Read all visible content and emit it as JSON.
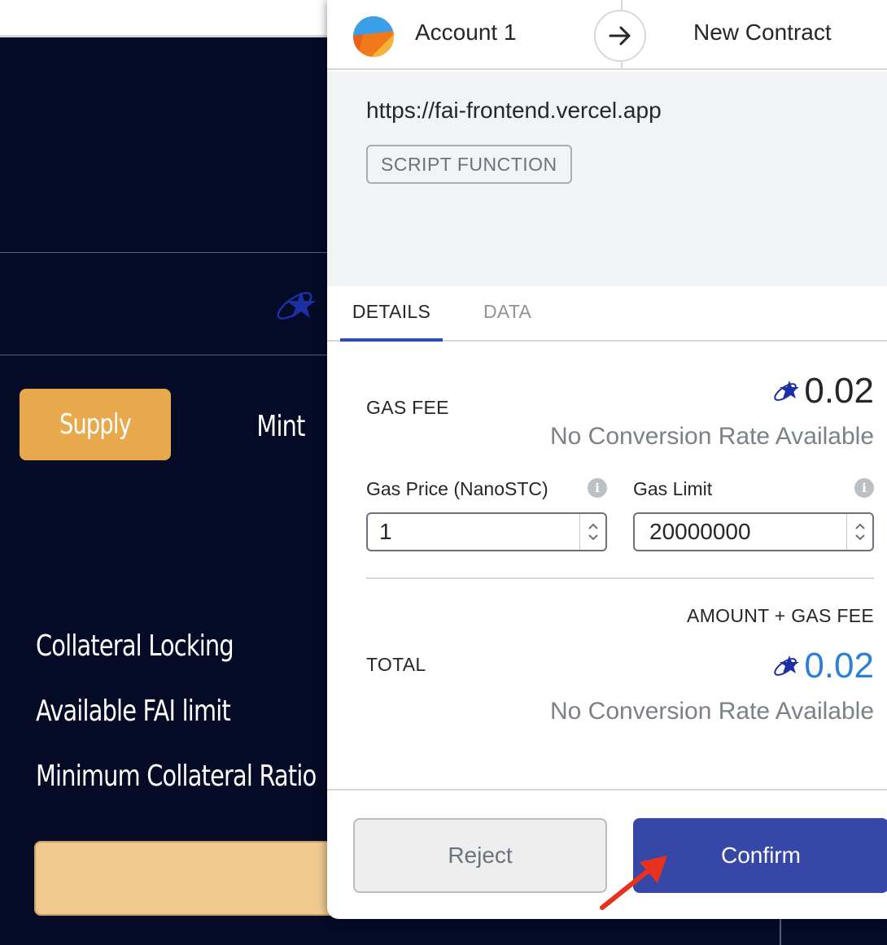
{
  "background_app": {
    "tabs": {
      "supply_label": "Supply",
      "mint_label": "Mint"
    },
    "labels": {
      "collateral_locking": "Collateral Locking",
      "available_fai_limit": "Available FAI limit",
      "minimum_collateral_ratio": "Minimum Collateral Ratio"
    }
  },
  "popup": {
    "header": {
      "account_name": "Account 1",
      "recipient": "New Contract"
    },
    "origin": {
      "url": "https://fai-frontend.vercel.app",
      "function_badge": "SCRIPT FUNCTION"
    },
    "tabs": {
      "details": "DETAILS",
      "data": "DATA"
    },
    "gas_fee": {
      "label": "GAS FEE",
      "amount": "0.02",
      "conversion": "No Conversion Rate Available"
    },
    "gas_price": {
      "label": "Gas Price (NanoSTC)",
      "value": "1"
    },
    "gas_limit": {
      "label": "Gas Limit",
      "value": "20000000"
    },
    "total": {
      "sublabel": "AMOUNT + GAS FEE",
      "label": "TOTAL",
      "amount": "0.02",
      "conversion": "No Conversion Rate Available"
    },
    "actions": {
      "reject_label": "Reject",
      "confirm_label": "Confirm"
    }
  },
  "icons": {
    "account_avatar": "avatar-icon",
    "arrow": "arrow-right-icon",
    "token": "starcoin-logo-icon",
    "info": "info-icon",
    "annotation": "red-arrow-annotation"
  },
  "colors": {
    "confirm_button": "#3747a8",
    "supply_button": "#e8a94d",
    "total_amount": "#2b7fd4",
    "background": "#050a26"
  }
}
